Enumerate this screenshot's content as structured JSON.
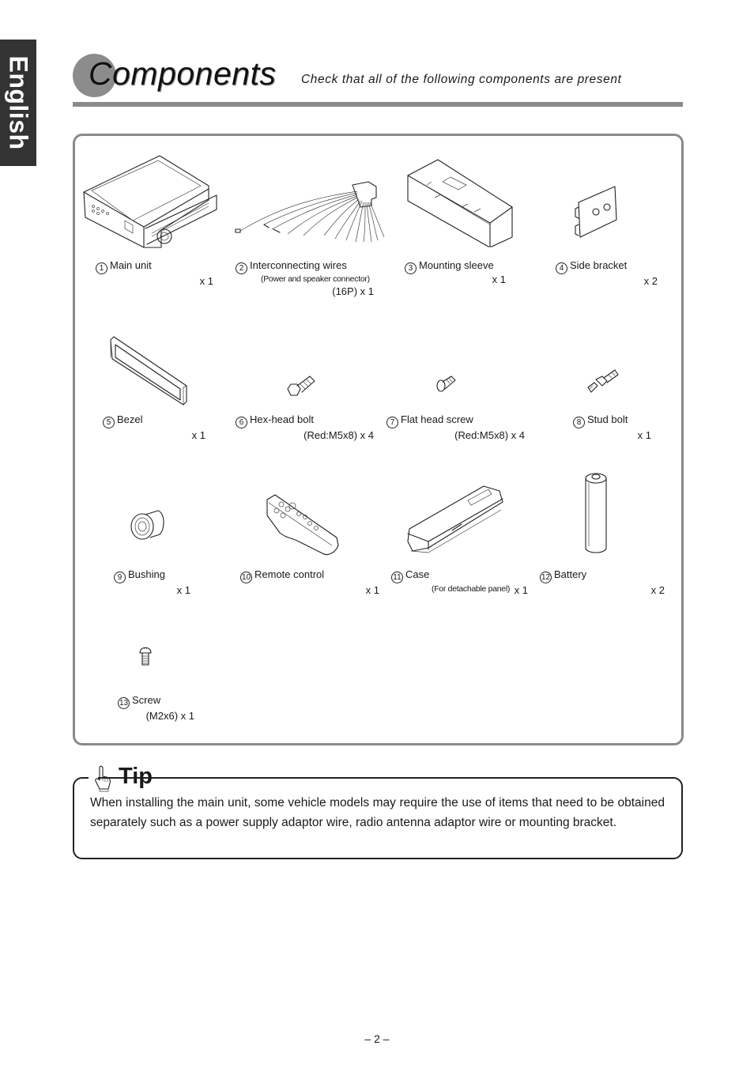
{
  "side_tab": {
    "label": "English"
  },
  "header": {
    "title": "Components",
    "subtitle": "Check that all of the following components are present"
  },
  "components": [
    {
      "number": "1",
      "name": "Main unit",
      "note": "",
      "quantity": "x 1",
      "icon": "main-unit-icon"
    },
    {
      "number": "2",
      "name": "Interconnecting wires",
      "note": "(Power and speaker connector)",
      "quantity": "(16P) x 1",
      "icon": "wires-icon"
    },
    {
      "number": "3",
      "name": "Mounting sleeve",
      "note": "",
      "quantity": "x 1",
      "icon": "mounting-sleeve-icon"
    },
    {
      "number": "4",
      "name": "Side bracket",
      "note": "",
      "quantity": "x 2",
      "icon": "side-bracket-icon"
    },
    {
      "number": "5",
      "name": "Bezel",
      "note": "",
      "quantity": "x 1",
      "icon": "bezel-icon"
    },
    {
      "number": "6",
      "name": "Hex-head bolt",
      "note": "",
      "quantity": "(Red:M5x8) x 4",
      "icon": "hex-bolt-icon"
    },
    {
      "number": "7",
      "name": "Flat head screw",
      "note": "",
      "quantity": "(Red:M5x8) x 4",
      "icon": "flat-screw-icon"
    },
    {
      "number": "8",
      "name": "Stud bolt",
      "note": "",
      "quantity": "x 1",
      "icon": "stud-bolt-icon"
    },
    {
      "number": "9",
      "name": "Bushing",
      "note": "",
      "quantity": "x 1",
      "icon": "bushing-icon"
    },
    {
      "number": "10",
      "name": "Remote control",
      "note": "",
      "quantity": "x 1",
      "icon": "remote-control-icon"
    },
    {
      "number": "11",
      "name": "Case",
      "note": "(For detachable panel)",
      "quantity": "x 1",
      "icon": "case-icon"
    },
    {
      "number": "12",
      "name": "Battery",
      "note": "",
      "quantity": "x 2",
      "icon": "battery-icon"
    },
    {
      "number": "13",
      "name": "Screw",
      "note": "",
      "quantity": "(M2x6) x 1",
      "icon": "screw-icon"
    }
  ],
  "tip": {
    "title": "Tip",
    "icon": "pointing-hand-icon",
    "text": "When installing the main unit, some vehicle models may require the use of items that need to be obtained separately such as a power supply adaptor wire, radio antenna adaptor wire or mounting bracket."
  },
  "footer": {
    "page_number": "– 2 –"
  }
}
